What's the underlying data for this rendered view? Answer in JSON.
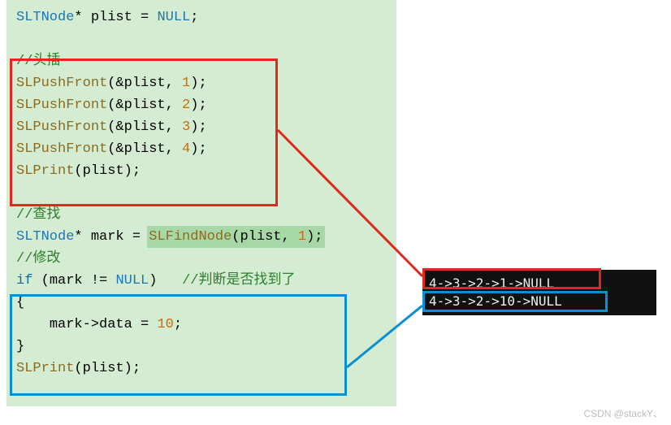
{
  "code": {
    "l1_type": "SLTNode",
    "l1_var": "plist",
    "l1_null": "NULL",
    "c1": "//头插",
    "push_fn": "SLPushFront",
    "push_arg_var": "&plist",
    "push_vals": [
      "1",
      "2",
      "3",
      "4"
    ],
    "print_fn": "SLPrint",
    "print_arg": "plist",
    "c2": "//查找",
    "find_line_type": "SLTNode",
    "find_var": "mark",
    "find_fn": "SLFindNode",
    "find_args_a": "plist",
    "find_args_b": "1",
    "c3": "//修改",
    "if_kw": "if",
    "if_cond_a": "mark",
    "if_cond_op": "!=",
    "if_cond_b": "NULL",
    "if_comment": "//判断是否找到了",
    "brace_open": "{",
    "assign_l": "mark->data",
    "assign_r": "10",
    "brace_close": "}"
  },
  "output": {
    "line1": "4->3->2->1->NULL",
    "line2": "4->3->2->10->NULL"
  },
  "watermark": "CSDN @stackY、"
}
